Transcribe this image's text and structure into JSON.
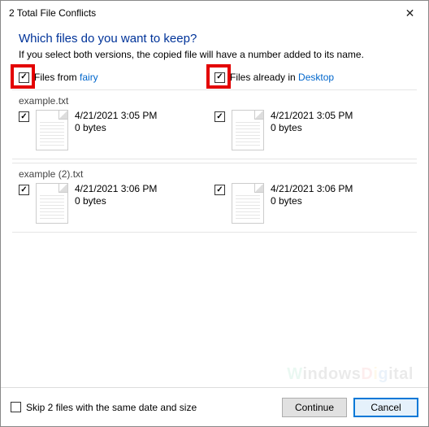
{
  "titlebar": {
    "title": "2 Total File Conflicts"
  },
  "header": {
    "title": "Which files do you want to keep?",
    "subtitle": "If you select both versions, the copied file will have a number added to its name."
  },
  "columns": {
    "source": {
      "prefix": "Files from ",
      "location": "fairy"
    },
    "dest": {
      "prefix": "Files already in ",
      "location": "Desktop"
    }
  },
  "groups": [
    {
      "name": "example.txt",
      "source": {
        "date": "4/21/2021 3:05 PM",
        "size": "0 bytes"
      },
      "dest": {
        "date": "4/21/2021 3:05 PM",
        "size": "0 bytes"
      }
    },
    {
      "name": "example (2).txt",
      "source": {
        "date": "4/21/2021 3:06 PM",
        "size": "0 bytes"
      },
      "dest": {
        "date": "4/21/2021 3:06 PM",
        "size": "0 bytes"
      }
    }
  ],
  "footer": {
    "skip_label": "Skip 2 files with the same date and size",
    "continue": "Continue",
    "cancel": "Cancel"
  },
  "watermark": "WindowsDigital"
}
